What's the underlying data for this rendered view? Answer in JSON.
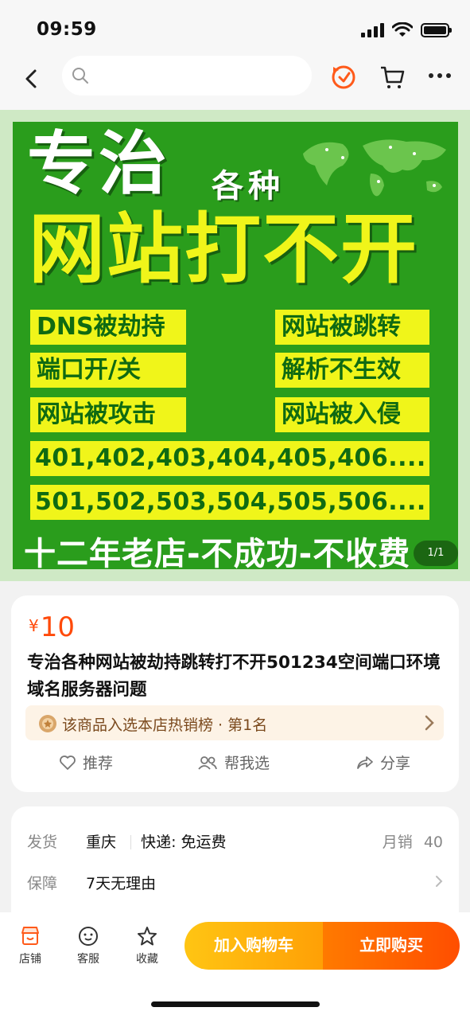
{
  "status_bar": {
    "time": "09:59"
  },
  "search": {
    "placeholder": ""
  },
  "banner": {
    "headline_1": "专治",
    "headline_1_small": "各种",
    "headline_2": "网站打不开",
    "tags": [
      "DNS被劫持",
      "网站被跳转",
      "端口开/关",
      "解析不生效",
      "网站被攻击",
      "网站被入侵"
    ],
    "codes_1": "401,402,403,404,405,406....",
    "codes_2": "501,502,503,504,505,506....",
    "slogan": "十二年老店-不成功-不收费",
    "counter": "1/1"
  },
  "product": {
    "currency": "¥",
    "price": "10",
    "title": "专治各种网站被劫持跳转打不开501234空间端口环境域名服务器问题",
    "rank_text": "该商品入选本店热销榜 · 第1名",
    "actions": {
      "recommend": "推荐",
      "help_choose": "帮我选",
      "share": "分享"
    }
  },
  "shipping": {
    "ship_label": "发货",
    "ship_from": "重庆",
    "express": "快递: 免运费",
    "monthly_sales_label": "月销",
    "monthly_sales": "40",
    "guarantee_label": "保障",
    "guarantee": "7天无理由"
  },
  "bottom": {
    "shop": "店铺",
    "service": "客服",
    "favorite": "收藏",
    "add_to_cart": "加入购物车",
    "buy_now": "立即购买"
  },
  "colors": {
    "accent": "#ff4a0a",
    "cart_button": "#ffb30d",
    "buy_button": "#ff5a00",
    "banner_green": "#2a9d1c",
    "banner_yellow": "#f0f51a"
  }
}
